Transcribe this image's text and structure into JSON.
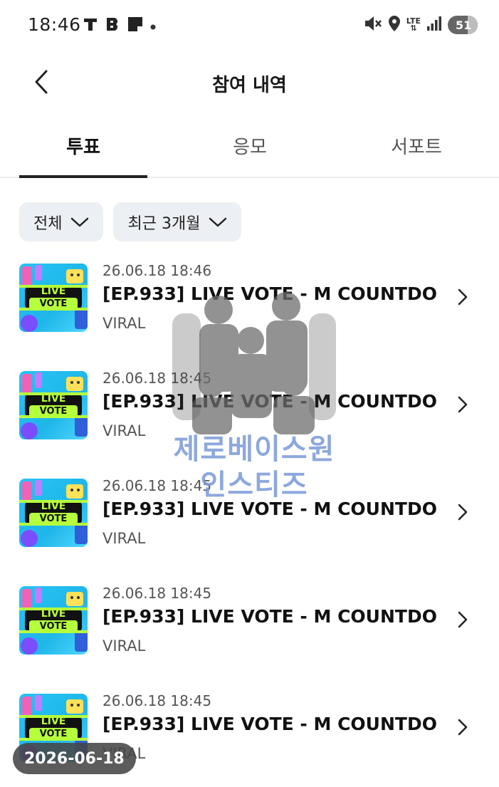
{
  "status_bar": {
    "time": "18:46",
    "left_icons": [
      "t-app-icon",
      "b-app-icon",
      "note-app-icon",
      "dot-icon"
    ],
    "right_icons": [
      "mute-icon",
      "location-icon",
      "lte-icon",
      "signal-icon"
    ],
    "lte_label": "LTE",
    "battery": "51"
  },
  "header": {
    "title": "참여 내역"
  },
  "tabs": [
    {
      "label": "투표",
      "active": true
    },
    {
      "label": "응모",
      "active": false
    },
    {
      "label": "서포트",
      "active": false
    }
  ],
  "filters": {
    "period_all": "전체",
    "period_recent": "최근 3개월"
  },
  "items": [
    {
      "date": "26.06.18 18:46",
      "title": "[EP.933] LIVE VOTE - M COUNTDO...",
      "sub": "VIRAL",
      "thumb_top": "LIVE",
      "thumb_bottom": "VOTE"
    },
    {
      "date": "26.06.18 18:45",
      "title": "[EP.933] LIVE VOTE - M COUNTDO...",
      "sub": "VIRAL",
      "thumb_top": "LIVE",
      "thumb_bottom": "VOTE"
    },
    {
      "date": "26.06.18 18:45",
      "title": "[EP.933] LIVE VOTE - M COUNTDO...",
      "sub": "VIRAL",
      "thumb_top": "LIVE",
      "thumb_bottom": "VOTE"
    },
    {
      "date": "26.06.18 18:45",
      "title": "[EP.933] LIVE VOTE - M COUNTDO...",
      "sub": "VIRAL",
      "thumb_top": "LIVE",
      "thumb_bottom": "VOTE"
    },
    {
      "date": "26.06.18 18:45",
      "title": "[EP.933] LIVE VOTE - M COUNTDO...",
      "sub": "VIRAL",
      "thumb_top": "LIVE",
      "thumb_bottom": "VOTE"
    }
  ],
  "watermark": {
    "line1": "제로베이스원",
    "line2": "인스티즈"
  },
  "date_stamp": "2026-06-18",
  "colors": {
    "chip_bg": "#eceff3",
    "tab_underline": "#222222",
    "watermark_text": "#7a9ad8"
  }
}
